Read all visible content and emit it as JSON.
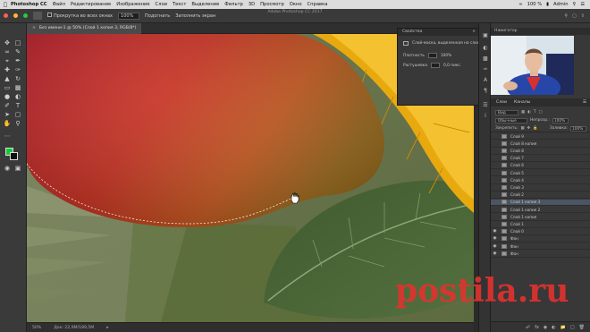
{
  "menubar": {
    "app_name": "Photoshop CC",
    "items": [
      "Файл",
      "Редактирование",
      "Изображение",
      "Слои",
      "Текст",
      "Выделение",
      "Фильтр",
      "3D",
      "Просмотр",
      "Окно",
      "Справка"
    ],
    "status": {
      "battery": "100 %",
      "user": "Admin"
    }
  },
  "optionsbar": {
    "app_title": "Adobe Photoshop CC 2017",
    "scroll_all_windows": "Прокрутка во всех окнах",
    "zoom_field": "100%",
    "fit_screen": "Подогнать",
    "fill_screen": "Заполнить экран"
  },
  "document": {
    "tab_title": "Без имени-1 @ 50% (Слой 1 копия 3, RGB/8*)",
    "status_zoom": "50%",
    "status_doc": "Док: 22,9M/189,5M"
  },
  "dialog": {
    "title": "Свойства",
    "row1": "Слой-маска, выделенная на слое",
    "row2_a": "Плотность",
    "row2_b": "100%",
    "row3_a": "Растушевка",
    "row3_b": "0,0 пикс."
  },
  "webcam_panel": {
    "title": "Навигатор"
  },
  "layers_panel": {
    "tabs": [
      "Слои",
      "Каналы"
    ],
    "filter_label": "Вид",
    "blend_mode": "Обычные",
    "opacity_label": "Непрозр.:",
    "opacity_value": "100%",
    "fill_label": "Заливка:",
    "fill_value": "100%",
    "lock_label": "Закрепить:",
    "layers": [
      {
        "name": "Слой 9",
        "visible": false,
        "selected": false
      },
      {
        "name": "Слой 8 копия",
        "visible": false,
        "selected": false
      },
      {
        "name": "Слой 8",
        "visible": false,
        "selected": false
      },
      {
        "name": "Слой 7",
        "visible": false,
        "selected": false
      },
      {
        "name": "Слой 6",
        "visible": false,
        "selected": false
      },
      {
        "name": "Слой 5",
        "visible": false,
        "selected": false
      },
      {
        "name": "Слой 4",
        "visible": false,
        "selected": false
      },
      {
        "name": "Слой 3",
        "visible": false,
        "selected": false
      },
      {
        "name": "Слой 2",
        "visible": false,
        "selected": false
      },
      {
        "name": "Слой 1 копия 3",
        "visible": false,
        "selected": true
      },
      {
        "name": "Слой 1 копия 2",
        "visible": false,
        "selected": false
      },
      {
        "name": "Слой 1 копия",
        "visible": false,
        "selected": false
      },
      {
        "name": "Слой 1",
        "visible": false,
        "selected": false
      },
      {
        "name": "Слой 0",
        "visible": true,
        "selected": false
      },
      {
        "name": "Фон",
        "visible": true,
        "selected": false
      },
      {
        "name": "Фон",
        "visible": true,
        "selected": false
      },
      {
        "name": "Фон",
        "visible": true,
        "selected": false
      }
    ]
  },
  "colors": {
    "foreground": "#19c93a",
    "background": "#0f0f0f",
    "watermark": "#e3322f"
  },
  "watermark": "postila.ru"
}
